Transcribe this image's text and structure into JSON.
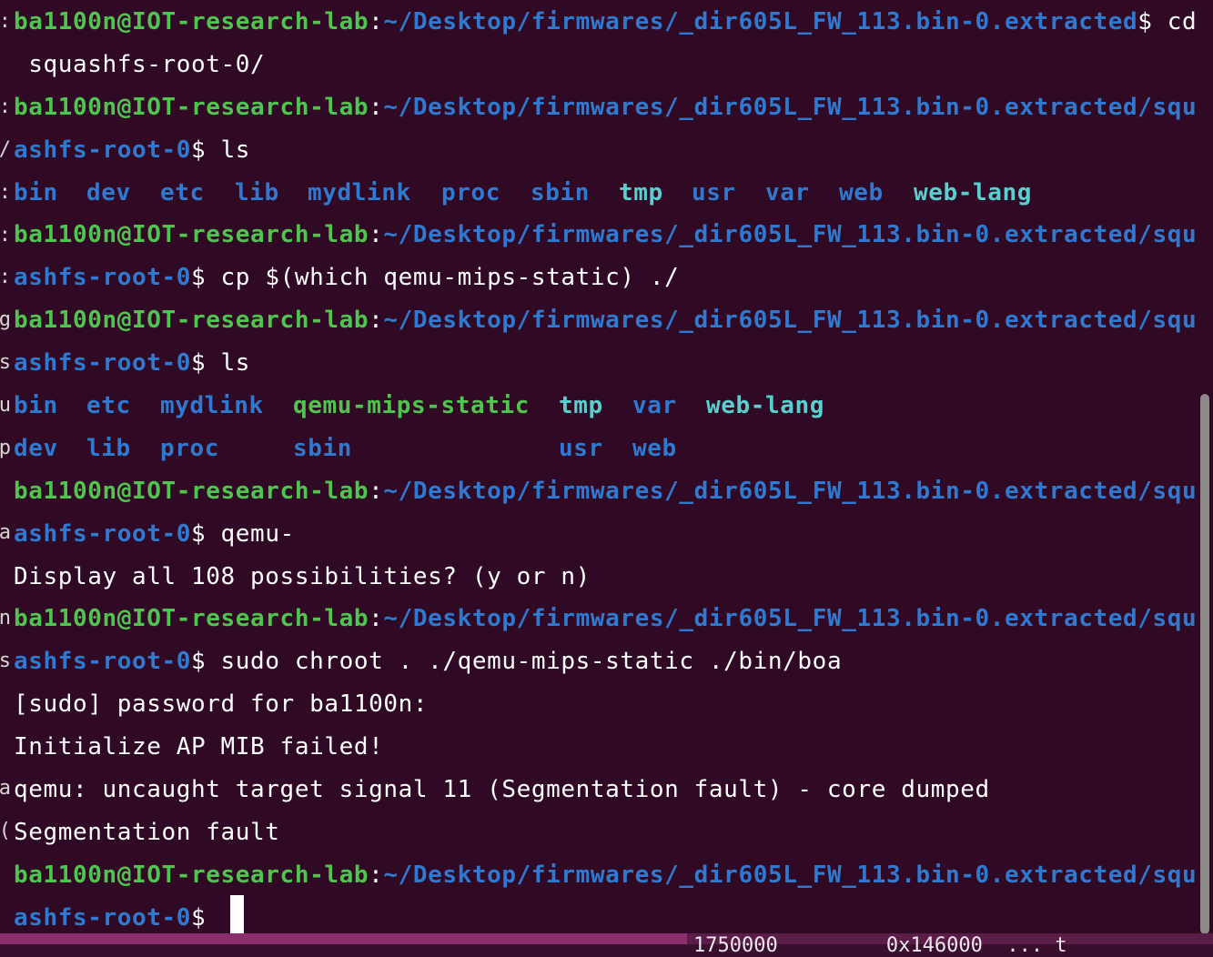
{
  "prompt": {
    "user_host": "ba1100n@IOT-research-lab",
    "path_short": "~/Desktop/firmwares/_dir605L_FW_113.bin-0.extracted",
    "path_wrap_first": "~/Desktop/firmwares/_dir605L_FW_113.bin-0.extracted/squ",
    "path_wrap_second": "ashfs-root-0"
  },
  "lines": {
    "l1_cmd": "$ cd",
    "l2_text": " squashfs-root-0/",
    "l4_cmd": "$ ls",
    "ls1": [
      "bin",
      "dev",
      "etc",
      "lib",
      "mydlink",
      "proc",
      "sbin",
      "tmp",
      "usr",
      "var",
      "web",
      "web-lang"
    ],
    "l7_cmd": "$ cp $(which qemu-mips-static) ./",
    "l9_cmd": "$ ls",
    "ls2_row1": [
      "bin",
      "etc",
      "mydlink",
      "qemu-mips-static",
      "tmp",
      "var",
      "web-lang"
    ],
    "ls2_row2": [
      "dev",
      "lib",
      "proc",
      "sbin",
      "usr",
      "web"
    ],
    "l13_cmd": "$ qemu-",
    "l14_text": "Display all 108 possibilities? (y or n)",
    "l16_cmd": "$ sudo chroot . ./qemu-mips-static ./bin/boa",
    "l17_text": "[sudo] password for ba1100n:",
    "l18_text": "Initialize AP MIB failed!",
    "l19_text": "qemu: uncaught target signal 11 (Segmentation fault) - core dumped",
    "l20_text": "Segmentation fault",
    "l22_cmd": "$ "
  },
  "left_strip": [
    ":",
    "",
    ":",
    "/",
    ":",
    ":",
    ":",
    "g",
    "s",
    "u",
    "p",
    "",
    "a",
    "",
    "n",
    "s",
    "",
    "",
    "a",
    "(",
    "",
    ""
  ],
  "background_window_text": "1750000         0x146000  ... t",
  "colors": {
    "background": "#300a24",
    "user": "#4fc54f",
    "path": "#2f79d0",
    "text": "#ffffff",
    "sticky_dir": "#5acfcf",
    "executable": "#4fc54f"
  }
}
